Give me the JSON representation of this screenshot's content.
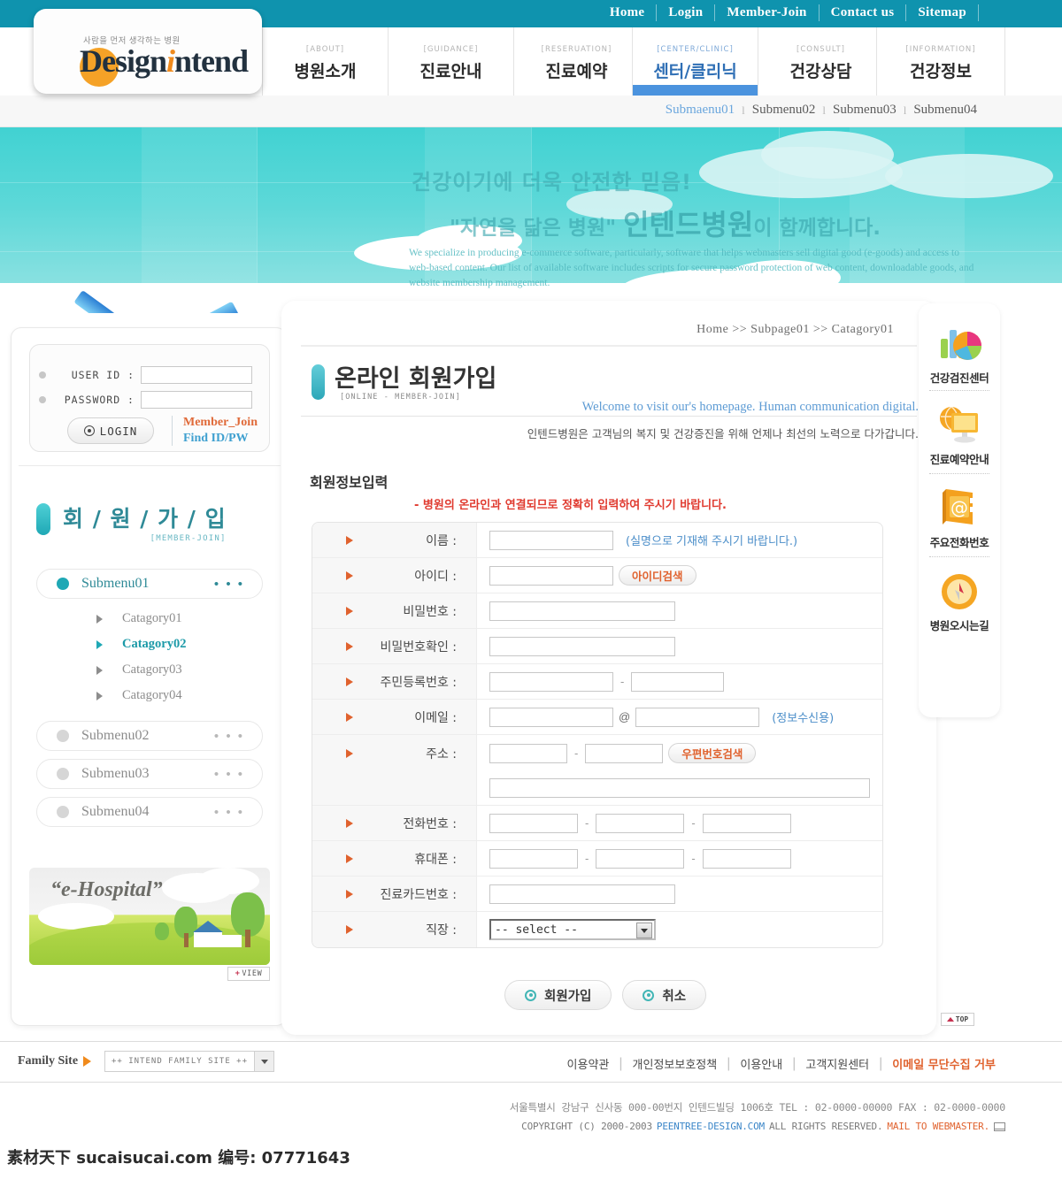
{
  "header": {
    "logo": {
      "tagline": "사람을 먼저 생각하는 병원",
      "name_part1": "D",
      "name_part2": "esign",
      "name_part3": "i",
      "name_part4": "ntend"
    },
    "utility_nav": [
      {
        "label": "Home"
      },
      {
        "label": "Login"
      },
      {
        "label": "Member-Join"
      },
      {
        "label": "Contact us"
      },
      {
        "label": "Sitemap"
      }
    ],
    "main_nav": [
      {
        "en": "[ABOUT]",
        "ko": "병원소개",
        "active": false
      },
      {
        "en": "[GUIDANCE]",
        "ko": "진료안내",
        "active": false
      },
      {
        "en": "[RESERUATION]",
        "ko": "진료예약",
        "active": false
      },
      {
        "en": "[CENTER/CLINIC]",
        "ko": "센터/클리닉",
        "active": true
      },
      {
        "en": "[CONSULT]",
        "ko": "건강상담",
        "active": false
      },
      {
        "en": "[INFORMATION]",
        "ko": "건강정보",
        "active": false
      }
    ],
    "submenu": [
      {
        "label": "Submaenu01",
        "active": true
      },
      {
        "label": "Submenu02",
        "active": false
      },
      {
        "label": "Submenu03",
        "active": false
      },
      {
        "label": "Submenu04",
        "active": false
      }
    ],
    "submenu_separator": "l"
  },
  "hero": {
    "line1": "건강이기에 더욱 안전한 믿음!",
    "line2_prefix": "\"자연을 닮은 병원\" ",
    "line2_strong": "인텐드병원",
    "line2_suffix": "이 함께합니다.",
    "description": "We specialize in producing e-commerce software, particularly, software that helps webmasters sell digital good (e-goods) and access to web-based content. Our list of available software includes scripts for secure password protection of web content, downloadable goods, and website membership management."
  },
  "sidebar": {
    "login": {
      "userid_label": "USER ID :",
      "userid_value": "",
      "password_label": "PASSWORD :",
      "password_value": "",
      "login_button": "LOGIN",
      "member_join_link": "Member_Join",
      "find_id_link": "Find ID/PW"
    },
    "section_title_ko": "회 / 원 / 가 / 입",
    "section_title_en": "[MEMBER-JOIN]",
    "menu": [
      {
        "label": "Submenu01",
        "active": true,
        "dots": "• • •",
        "categories": [
          {
            "label": "Catagory01",
            "active": false
          },
          {
            "label": "Catagory02",
            "active": true
          },
          {
            "label": "Catagory03",
            "active": false
          },
          {
            "label": "Catagory04",
            "active": false
          }
        ]
      },
      {
        "label": "Submenu02",
        "active": false,
        "dots": "• • •",
        "categories": []
      },
      {
        "label": "Submenu03",
        "active": false,
        "dots": "• • •",
        "categories": []
      },
      {
        "label": "Submenu04",
        "active": false,
        "dots": "• • •",
        "categories": []
      }
    ],
    "banner": {
      "title": "“e-Hospital”",
      "view_button": "VIEW",
      "view_plus": "+"
    }
  },
  "content": {
    "breadcrumb": "Home  >>  Subpage01  >>  Catagory01",
    "title_ko": "온라인 회원가입",
    "title_en": "[ONLINE - MEMBER-JOIN]",
    "welcome_en": "Welcome to visit our's homepage. Human communication digital.",
    "welcome_ko": "인텐드병원은 고객님의 복지 및 건강증진을 위해 언제나 최선의 노력으로 다가갑니다.",
    "section_title": "회원정보입력",
    "section_note": "- 병원의 온라인과 연결되므로 정확히 입력하여 주시기 바랍니다.",
    "form_rows": [
      {
        "label": "이름 :",
        "type": "single_hint",
        "value": "",
        "hint": "(실명으로 기재해 주시기 바랍니다.)"
      },
      {
        "label": "아이디 :",
        "type": "single_button",
        "value": "",
        "button": "아이디검색"
      },
      {
        "label": "비밀번호 :",
        "type": "wide",
        "value": ""
      },
      {
        "label": "비밀번호확인 :",
        "type": "wide",
        "value": ""
      },
      {
        "label": "주민등록번호 :",
        "type": "two_part",
        "value1": "",
        "value2": "",
        "separator": "-"
      },
      {
        "label": "이메일 :",
        "type": "email",
        "value1": "",
        "value2": "",
        "at": "@",
        "hint": "(정보수신용)"
      },
      {
        "label": "주소 :",
        "type": "address",
        "value1": "",
        "value2": "",
        "value3": "",
        "separator": "-",
        "button": "우편번호검색"
      },
      {
        "label": "전화번호 :",
        "type": "three_part",
        "value1": "",
        "value2": "",
        "value3": "",
        "separator": "-"
      },
      {
        "label": "휴대폰 :",
        "type": "three_part",
        "value1": "",
        "value2": "",
        "value3": "",
        "separator": "-"
      },
      {
        "label": "진료카드번호 :",
        "type": "wide",
        "value": ""
      },
      {
        "label": "직장 :",
        "type": "select",
        "selected": "-- select --"
      }
    ],
    "submit_button": "회원가입",
    "cancel_button": "취소"
  },
  "quick_menu": {
    "items": [
      {
        "label": "건강검진센터",
        "icon": "chart-pie-icon"
      },
      {
        "label": "진료예약안내",
        "icon": "monitor-globe-icon"
      },
      {
        "label": "주요전화번호",
        "icon": "book-at-icon"
      },
      {
        "label": "병원오시는길",
        "icon": "compass-icon"
      }
    ],
    "top_button": "TOP"
  },
  "footer": {
    "family_site_label": "Family Site",
    "family_site_selected": "++ INTEND FAMILY SITE ++",
    "links": [
      {
        "label": "이용약관",
        "highlight": false
      },
      {
        "label": "개인정보보호정책",
        "highlight": false
      },
      {
        "label": "이용안내",
        "highlight": false
      },
      {
        "label": "고객지원센터",
        "highlight": false
      },
      {
        "label": "이메일 무단수집 거부",
        "highlight": true
      }
    ],
    "link_separator": "|",
    "address": "서울특별시  강남구 신사동 000-00번지 인텐드빌딩 1006호  TEL : 02-0000-00000  FAX : 02-0000-0000",
    "copyright_pre": "COPYRIGHT (C) 2000-2003 ",
    "copyright_site": "PEENTREE-DESIGN.COM",
    "copyright_mid": " ALL RIGHTS RESERVED. ",
    "copyright_mail": "MAIL TO WEBMASTER.",
    "watermark": "素材天下 sucaisucai.com  编号: 07771643"
  },
  "colors": {
    "teal_bar": "#0f93ae",
    "hero_top": "#41d2d2",
    "hero_bottom": "#9ae4e4",
    "accent_orange": "#e0622e",
    "accent_blue": "#4b93de",
    "note_red": "#e03a2f",
    "side_teal": "#2f8a97"
  }
}
